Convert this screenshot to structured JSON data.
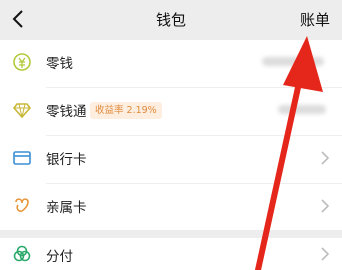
{
  "navbar": {
    "title": "钱包",
    "right_label": "账单"
  },
  "rows": [
    {
      "label": "零钱",
      "icon": "coin-icon"
    },
    {
      "label": "零钱通",
      "badge": "收益率 2.19%",
      "icon": "diamond-icon"
    },
    {
      "label": "银行卡",
      "icon": "bank-card-icon"
    },
    {
      "label": "亲属卡",
      "icon": "family-card-icon"
    }
  ],
  "install": {
    "label": "分付",
    "icon": "installment-icon"
  },
  "colors": {
    "accent_green": "#b2c93a",
    "arrow_red": "#e5261b",
    "badge_orange": "#e08a3c"
  }
}
